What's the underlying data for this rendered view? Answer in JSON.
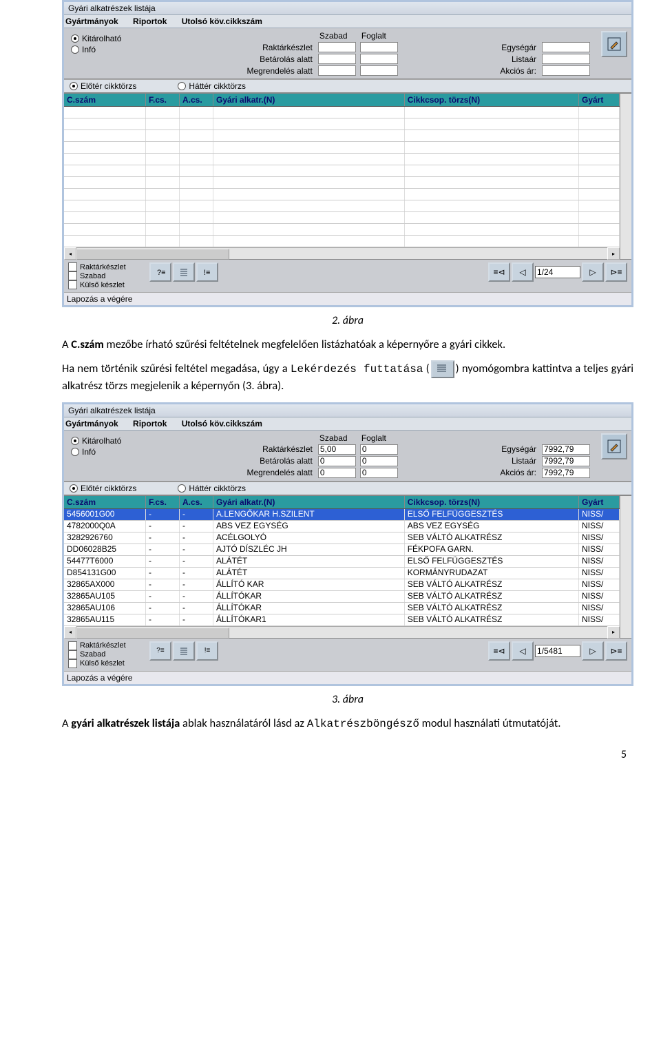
{
  "caption1": "2. ábra",
  "caption2": "3. ábra",
  "p1_pre": "A ",
  "p1_bold": "C.szám",
  "p1_rest": " mezőbe írható szűrési feltételnek megfelelően listázhatóak a képernyőre a gyári cikkek.",
  "p2_a": "Ha nem történik szűrési feltétel megadása, úgy a ",
  "p2_tt1": "Lekérdezés futtatása",
  "p2_b": " (",
  "p2_c": ") nyomógombra kattintva a teljes gyári alkatrész törzs megjelenik a képernyőn (3. ábra).",
  "p3_a": "A ",
  "p3_b": "gyári alkatrészek listája",
  "p3_c": " ablak használatáról lásd az ",
  "p3_tt": "Alkatrészböngésző",
  "p3_d": " modul használati útmutatóját.",
  "pagenum": "5",
  "win": {
    "title": "Gyári alkatrészek listája",
    "menu": [
      "Gyártmányok",
      "Riportok",
      "Utolsó köv.cikkszám"
    ],
    "radios_left": [
      "Kitárolható",
      "Infó"
    ],
    "hdr_szabad": "Szabad",
    "hdr_foglalt": "Foglalt",
    "lab_rk": "Raktárkészlet",
    "lab_bet": "Betárolás alatt",
    "lab_meg": "Megrendelés alatt",
    "lab_egy": "Egységár",
    "lab_list": "Listaár",
    "lab_akc": "Akciós ár:",
    "tabs": [
      "Előtér cikktörzs",
      "Háttér cikktörzs"
    ],
    "cols": [
      "C.szám",
      "F.cs.",
      "A.cs.",
      "Gyári alkatr.(N)",
      "Cikkcsop. törzs(N)",
      "Gyárt"
    ],
    "chks": [
      "Raktárkészlet",
      "Szabad",
      "Külső készlet"
    ],
    "status": "Lapozás a végére"
  },
  "fig1": {
    "vals": {
      "rk_s": "",
      "rk_f": "",
      "bet_s": "",
      "bet_f": "",
      "meg_s": "",
      "meg_f": "",
      "egy": "",
      "list": "",
      "akc": ""
    },
    "rows": [],
    "pager": "1/24"
  },
  "fig2": {
    "vals": {
      "rk_s": "5,00",
      "rk_f": "0",
      "bet_s": "0",
      "bet_f": "0",
      "meg_s": "0",
      "meg_f": "0",
      "egy": "7992,79",
      "list": "7992,79",
      "akc": "7992,79"
    },
    "rows": [
      {
        "c1": "5456001G00",
        "c2": "-",
        "c3": "-",
        "c4": "A.LENGŐKAR H.SZILENT",
        "c5": "ELSŐ FELFÜGGESZTÉS",
        "c6": "NISS/",
        "sel": true
      },
      {
        "c1": "4782000Q0A",
        "c2": "-",
        "c3": "-",
        "c4": "ABS VEZ EGYSÉG",
        "c5": "ABS VEZ EGYSÉG",
        "c6": "NISS/"
      },
      {
        "c1": "3282926760",
        "c2": "-",
        "c3": "-",
        "c4": "ACÉLGOLYÓ",
        "c5": "SEB VÁLTÓ ALKATRÉSZ",
        "c6": "NISS/"
      },
      {
        "c1": "DD06028B25",
        "c2": "-",
        "c3": "-",
        "c4": "AJTÓ DÍSZLÉC JH",
        "c5": "FÉKPOFA GARN.",
        "c6": "NISS/"
      },
      {
        "c1": "54477T6000",
        "c2": "-",
        "c3": "-",
        "c4": "ALÁTÉT",
        "c5": "ELSŐ FELFÜGGESZTÉS",
        "c6": "NISS/"
      },
      {
        "c1": "D854131G00",
        "c2": "-",
        "c3": "-",
        "c4": "ALÁTÉT",
        "c5": "KORMÁNYRUDAZAT",
        "c6": "NISS/"
      },
      {
        "c1": "32865AX000",
        "c2": "-",
        "c3": "-",
        "c4": "ÁLLÍTÓ KAR",
        "c5": "SEB VÁLTÓ ALKATRÉSZ",
        "c6": "NISS/"
      },
      {
        "c1": "32865AU105",
        "c2": "-",
        "c3": "-",
        "c4": "ÁLLÍTÓKAR",
        "c5": "SEB VÁLTÓ ALKATRÉSZ",
        "c6": "NISS/"
      },
      {
        "c1": "32865AU106",
        "c2": "-",
        "c3": "-",
        "c4": "ÁLLÍTÓKAR",
        "c5": "SEB VÁLTÓ ALKATRÉSZ",
        "c6": "NISS/"
      },
      {
        "c1": "32865AU115",
        "c2": "-",
        "c3": "-",
        "c4": "ÁLLÍTÓKAR1",
        "c5": "SEB VÁLTÓ ALKATRÉSZ",
        "c6": "NISS/"
      }
    ],
    "pager": "1/5481"
  }
}
